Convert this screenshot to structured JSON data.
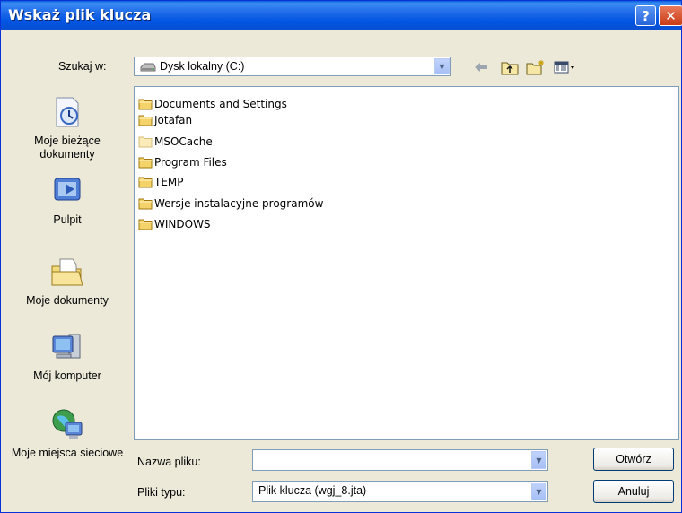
{
  "window": {
    "title": "Wskaż plik klucza",
    "help_glyph": "?",
    "close_glyph": "✕"
  },
  "toolbar": {
    "look_in_label": "Szukaj w:",
    "look_in_value": "Dysk lokalny (C:)"
  },
  "places": [
    {
      "label": "Moje bieżące dokumenty",
      "icon": "recent-documents-icon"
    },
    {
      "label": "Pulpit",
      "icon": "desktop-icon"
    },
    {
      "label": "Moje dokumenty",
      "icon": "my-documents-icon"
    },
    {
      "label": "Mój komputer",
      "icon": "my-computer-icon"
    },
    {
      "label": "Moje miejsca sieciowe",
      "icon": "network-places-icon"
    }
  ],
  "folders": [
    "Documents and Settings",
    "Jotafan",
    "MSOCache",
    "Program Files",
    "TEMP",
    "Wersje instalacyjne programów",
    "WINDOWS"
  ],
  "bottom": {
    "filename_label": "Nazwa pliku:",
    "filename_value": "",
    "filetype_label": "Pliki typu:",
    "filetype_value": "Plik klucza (wgj_8.jta)",
    "open_button": "Otwórz",
    "cancel_button": "Anuluj"
  }
}
